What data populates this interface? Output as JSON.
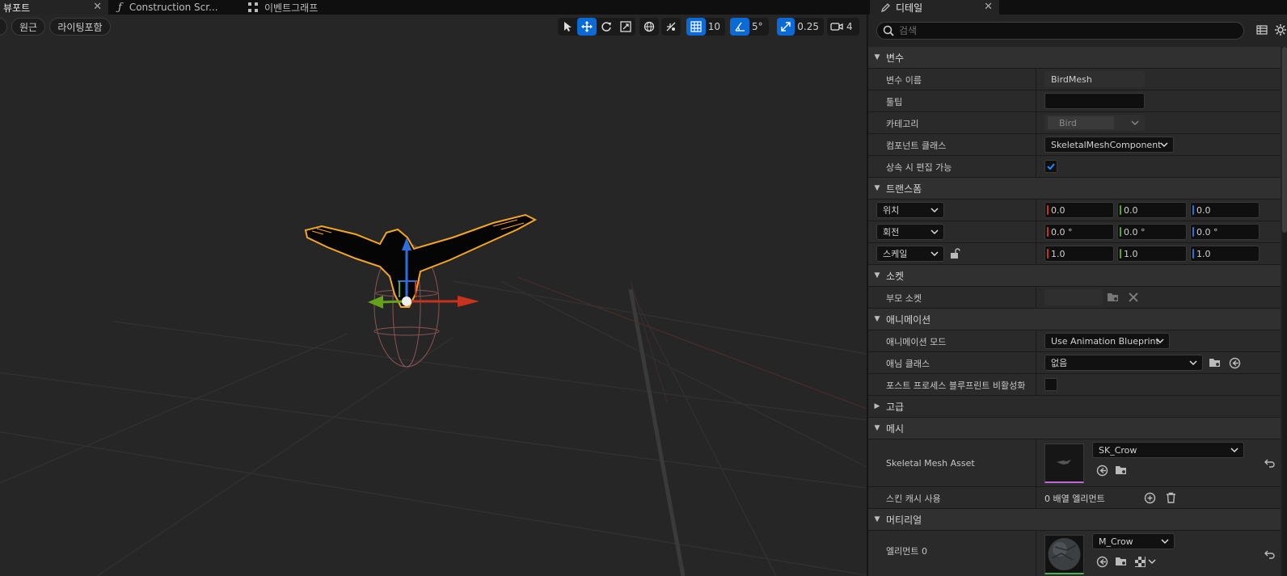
{
  "tabs": [
    {
      "label": "뷰포트",
      "close": "✕"
    },
    {
      "label": "Construction Scr..."
    },
    {
      "label": "이벤트그래프"
    },
    {
      "label": "디테일",
      "close": "✕"
    }
  ],
  "viewport": {
    "perspective_button": "원근",
    "lighting_button": "라이팅포함",
    "grid_snap_value": "10",
    "rotation_snap_value": "5°",
    "scale_snap_value": "0.25",
    "camera_speed_value": "4"
  },
  "details": {
    "search_placeholder": "검색",
    "categories": {
      "variable": "변수",
      "transform": "트랜스폼",
      "sockets": "소켓",
      "animation": "애니메이션",
      "advanced": "고급",
      "mesh": "메시",
      "materials": "머티리얼"
    },
    "variable": {
      "name_label": "변수 이름",
      "name_value": "BirdMesh",
      "tooltip_label": "툴팁",
      "tooltip_value": "",
      "category_label": "카테고리",
      "category_value": "Bird",
      "component_class_label": "컴포넌트 클래스",
      "component_class_value": "SkeletalMeshComponent",
      "editable_label": "상속 시 편집 가능",
      "editable_checked": true
    },
    "transform": {
      "location": {
        "label": "위치",
        "x": "0.0",
        "y": "0.0",
        "z": "0.0"
      },
      "rotation": {
        "label": "회전",
        "x": "0.0 °",
        "y": "0.0 °",
        "z": "0.0 °"
      },
      "scale": {
        "label": "스케일",
        "x": "1.0",
        "y": "1.0",
        "z": "1.0"
      }
    },
    "sockets": {
      "parent_socket_label": "부모 소켓",
      "parent_socket_value": ""
    },
    "animation": {
      "mode_label": "애니메이션 모드",
      "mode_value": "Use Animation Blueprint",
      "anim_class_label": "애님 클래스",
      "anim_class_value": "없음",
      "disable_post_process_label": "포스트 프로세스 블루프린트 비활성화",
      "disable_post_process_checked": false
    },
    "mesh": {
      "asset_label": "Skeletal Mesh Asset",
      "asset_value": "SK_Crow",
      "skin_cache_label": "스킨 캐시 사용",
      "skin_cache_value": "0 배열 엘리먼트"
    },
    "materials": {
      "element0_label": "엘리먼트 0",
      "element0_value": "M_Crow"
    }
  },
  "colors": {
    "accent": "#0a6bd6",
    "selection": "#f5a623",
    "axis_x": "#c8331e",
    "axis_y": "#64a21a",
    "axis_z": "#2e6fdc"
  }
}
